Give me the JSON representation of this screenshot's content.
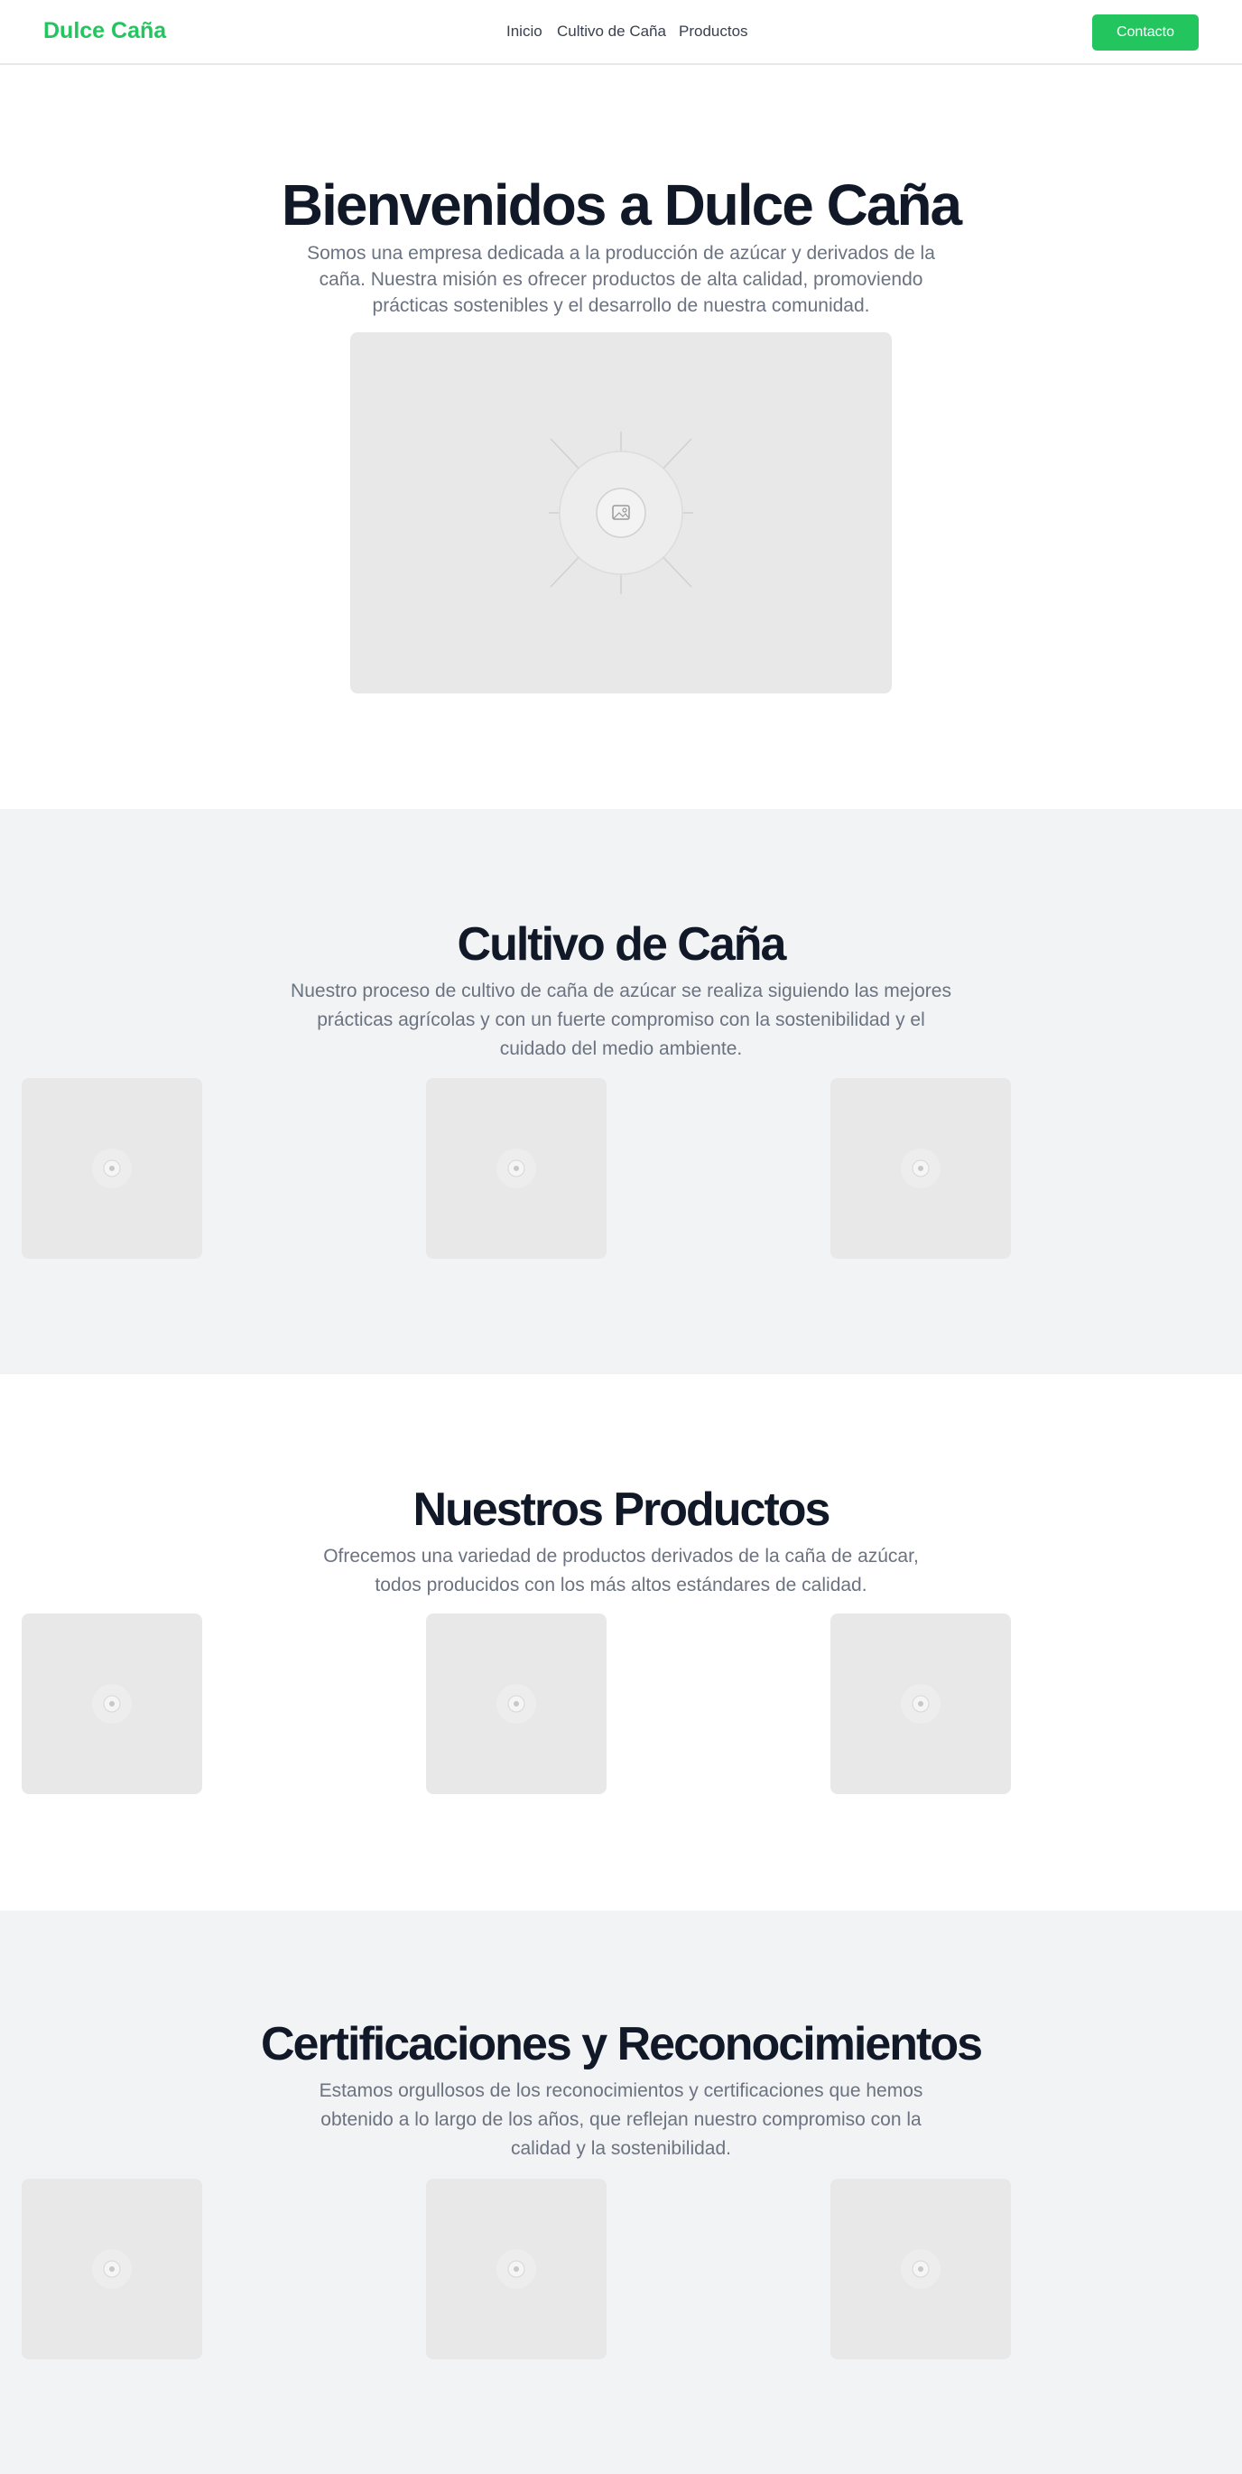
{
  "header": {
    "brand": "Dulce Caña",
    "nav": [
      "Inicio",
      "Cultivo de Caña",
      "Productos"
    ],
    "contact_label": "Contacto"
  },
  "hero": {
    "title": "Bienvenidos a Dulce Caña",
    "description": "Somos una empresa dedicada a la producción de azúcar y derivados de la caña. Nuestra misión es ofrecer productos de alta calidad, promoviendo prácticas sostenibles y el desarrollo de nuestra comunidad."
  },
  "cultivo": {
    "title": "Cultivo de Caña",
    "description": "Nuestro proceso de cultivo de caña de azúcar se realiza siguiendo las mejores prácticas agrícolas y con un fuerte compromiso con la sostenibilidad y el cuidado del medio ambiente."
  },
  "productos": {
    "title": "Nuestros Productos",
    "description": "Ofrecemos una variedad de productos derivados de la caña de azúcar, todos producidos con los más altos estándares de calidad."
  },
  "certificaciones": {
    "title": "Certificaciones y Reconocimientos",
    "description": "Estamos orgullosos de los reconocimientos y certificaciones que hemos obtenido a lo largo de los años, que reflejan nuestro compromiso con la calidad y la sostenibilidad."
  },
  "colors": {
    "accent": "#22c55e",
    "heading": "#111827",
    "muted_text": "#6b7280",
    "alt_section_bg": "#f2f3f5",
    "placeholder_bg": "#e8e8e8"
  },
  "icons": {
    "hero_image": "image-placeholder-icon",
    "card_image": "image-placeholder-icon"
  }
}
